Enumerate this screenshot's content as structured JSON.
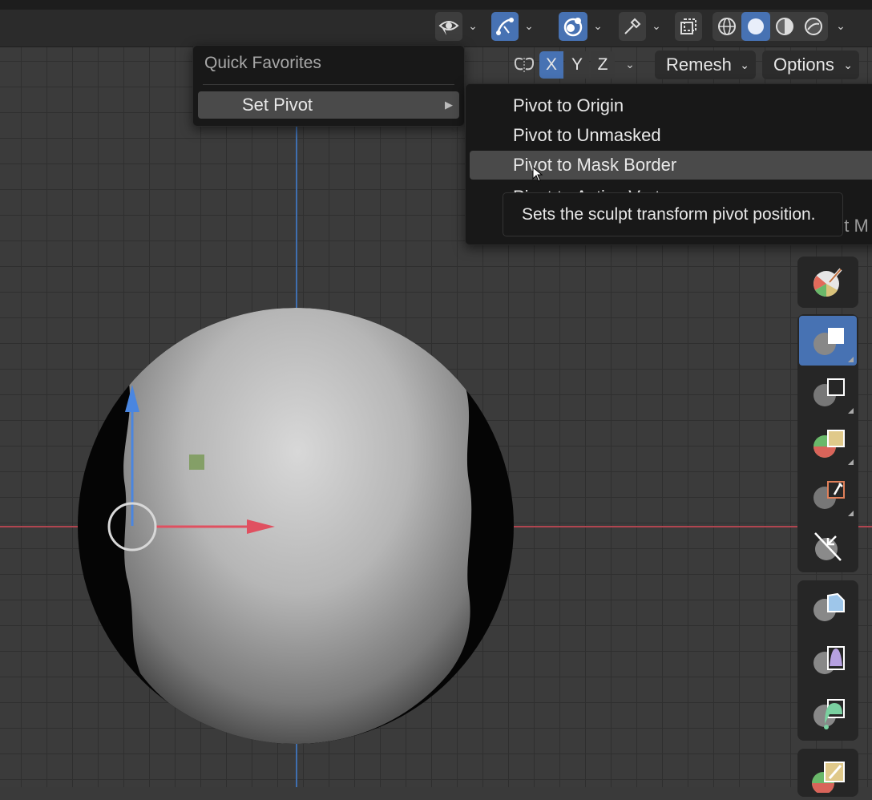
{
  "header": {
    "visibility_icon": "eye-icon",
    "snap_icon": "curve-snap-icon",
    "overlay_icon": "overlay-icon",
    "gizmo_icon": "eyedropper-icon",
    "xray_icon": "xray-icon",
    "shading_modes": [
      "wireframe-icon",
      "solid-icon",
      "material-icon",
      "rendered-icon"
    ],
    "active_shading": "solid"
  },
  "tool_settings": {
    "symmetry_icon": "butterfly-icon",
    "axes": [
      "X",
      "Y",
      "Z"
    ],
    "active_axes": [
      "X"
    ],
    "remesh_label": "Remesh",
    "options_label": "Options"
  },
  "quick_favorites": {
    "title": "Quick Favorites",
    "item_label": "Set Pivot",
    "item_arrow": "▶"
  },
  "pivot_menu": {
    "items": [
      {
        "label": "Pivot to Origin"
      },
      {
        "label": "Pivot to Unmasked"
      },
      {
        "label": "Pivot to Mask Border"
      },
      {
        "label": "Pivot to Active Vertex"
      }
    ],
    "highlighted_index": 2,
    "clipped_text": "nt M"
  },
  "tooltip": {
    "text": "Sets the sculpt transform pivot position."
  },
  "colors": {
    "accent": "#4772b3",
    "x_axis": "#e05060",
    "y_axis": "#4a86e0",
    "menu_bg": "#181818"
  },
  "sculpt_tools": [
    "draw-brush-icon",
    "box-mask-icon",
    "box-hide-icon",
    "box-face-set-icon",
    "box-trim-icon",
    "line-project-icon",
    "mesh-filter-icon",
    "cloth-filter-icon",
    "color-filter-icon",
    "edit-face-set-icon"
  ]
}
